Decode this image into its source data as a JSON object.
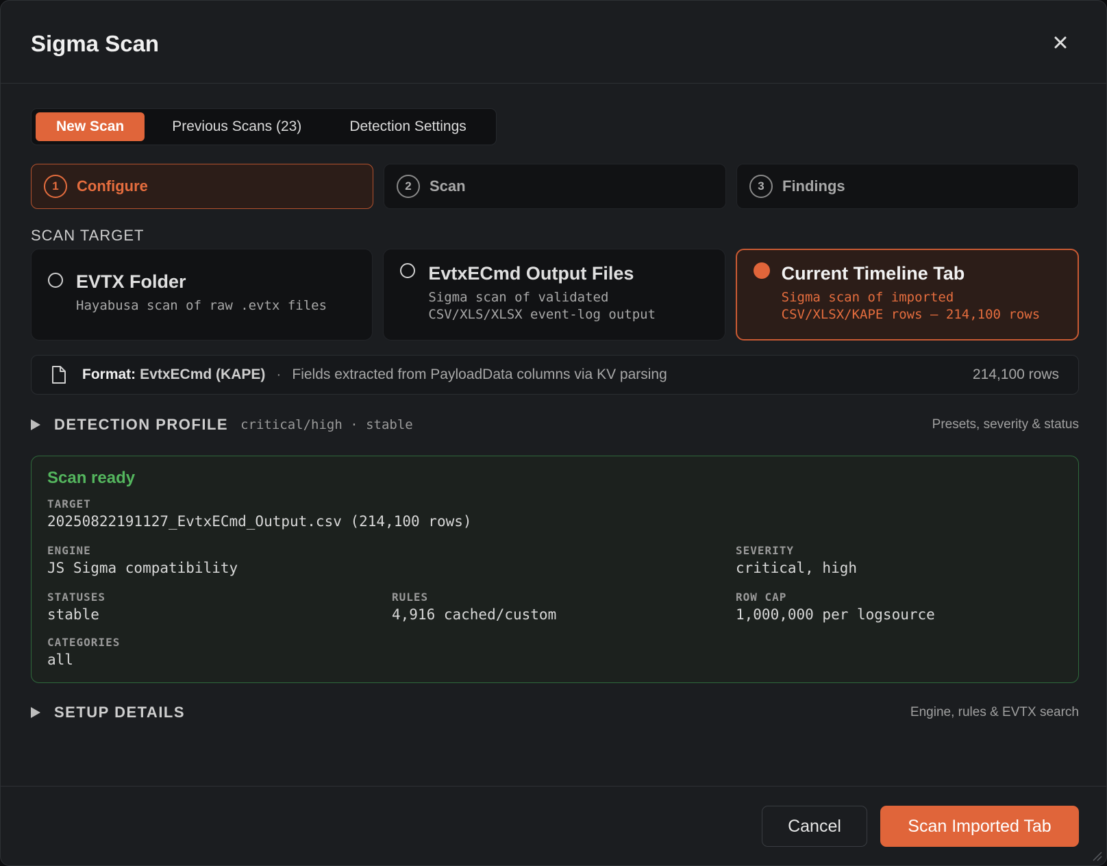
{
  "dialog": {
    "title": "Sigma Scan"
  },
  "tabs": [
    {
      "label": "New Scan"
    },
    {
      "label": "Previous Scans (23)"
    },
    {
      "label": "Detection Settings"
    }
  ],
  "steps": [
    {
      "num": "1",
      "label": "Configure"
    },
    {
      "num": "2",
      "label": "Scan"
    },
    {
      "num": "3",
      "label": "Findings"
    }
  ],
  "scan_target": {
    "label": "SCAN TARGET",
    "options": [
      {
        "title": "EVTX Folder",
        "desc": "Hayabusa scan of raw .evtx files",
        "selected": false
      },
      {
        "title": "EvtxECmd Output Files",
        "desc": "Sigma scan of validated\nCSV/XLS/XLSX event-log output",
        "selected": false
      },
      {
        "title": "Current Timeline Tab",
        "desc": "Sigma scan of imported\nCSV/XLSX/KAPE rows – 214,100 rows",
        "selected": true
      }
    ]
  },
  "format": {
    "key": "Format:",
    "value": "EvtxECmd (KAPE)",
    "separator": "·",
    "desc": "Fields extracted from PayloadData columns via KV parsing",
    "rows": "214,100 rows",
    "icon": "document-icon"
  },
  "detection_profile": {
    "title": "DETECTION PROFILE",
    "summary": "critical/high · stable",
    "right": "Presets, severity & status"
  },
  "ready": {
    "title": "Scan ready",
    "target_label": "TARGET",
    "target_value": "20250822191127_EvtxECmd_Output.csv (214,100 rows)",
    "engine_label": "ENGINE",
    "engine_value": "JS Sigma compatibility",
    "severity_label": "SEVERITY",
    "severity_value": "critical, high",
    "statuses_label": "STATUSES",
    "statuses_value": "stable",
    "rules_label": "RULES",
    "rules_value": "4,916 cached/custom",
    "rowcap_label": "ROW CAP",
    "rowcap_value": "1,000,000 per logsource",
    "categories_label": "CATEGORIES",
    "categories_value": "all"
  },
  "setup_details": {
    "title": "SETUP DETAILS",
    "right": "Engine, rules & EVTX search"
  },
  "footer": {
    "cancel_label": "Cancel",
    "primary_label": "Scan Imported Tab"
  },
  "colors": {
    "accent": "#e0653a",
    "success": "#54b65e",
    "background": "#1b1d20"
  }
}
